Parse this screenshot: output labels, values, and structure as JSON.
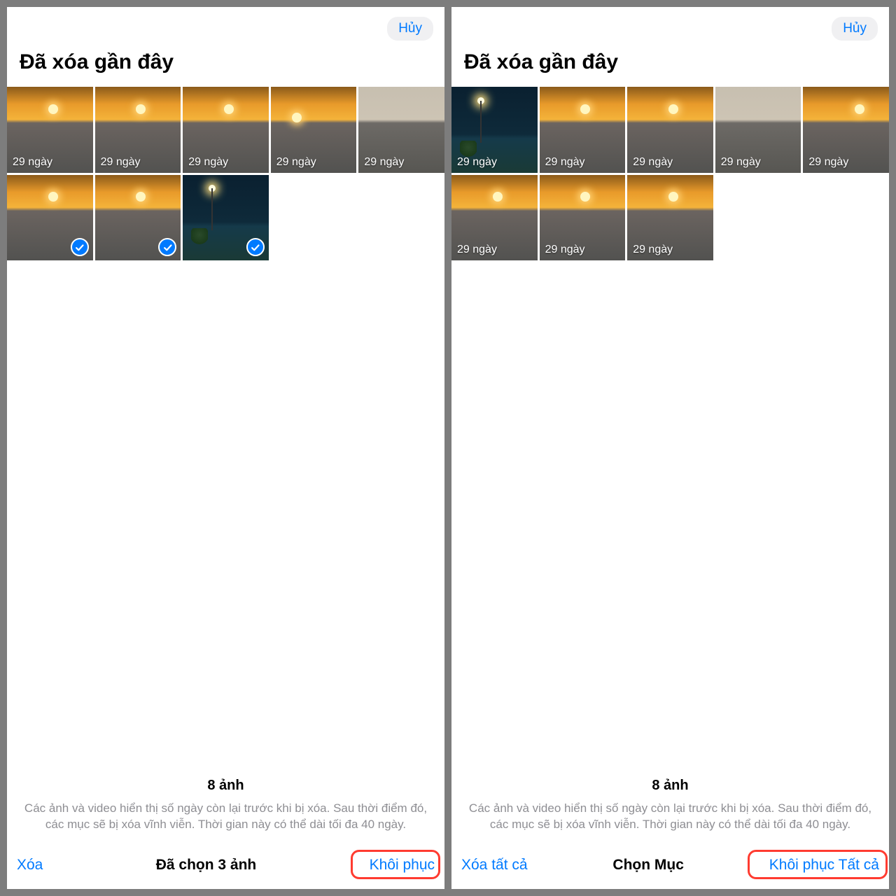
{
  "left": {
    "cancel": "Hủy",
    "title": "Đã xóa gần đây",
    "thumbs": [
      {
        "days": "29 ngày",
        "style": "sunset",
        "selected": false
      },
      {
        "days": "29 ngày",
        "style": "sunset",
        "selected": false
      },
      {
        "days": "29 ngày",
        "style": "sunset",
        "selected": false
      },
      {
        "days": "29 ngày",
        "style": "sunset_left",
        "selected": false
      },
      {
        "days": "29 ngày",
        "style": "sea",
        "selected": false
      },
      {
        "days": "",
        "style": "sunset",
        "selected": true
      },
      {
        "days": "",
        "style": "sunset",
        "selected": true
      },
      {
        "days": "",
        "style": "night",
        "selected": true
      }
    ],
    "count": "8 ảnh",
    "info": "Các ảnh và video hiển thị số ngày còn lại trước khi bị xóa. Sau thời điểm đó, các mục sẽ bị xóa vĩnh viễn. Thời gian này có thể dài tối đa 40 ngày.",
    "bb_left": "Xóa",
    "bb_center": "Đã chọn 3 ảnh",
    "bb_right": "Khôi phục"
  },
  "right": {
    "cancel": "Hủy",
    "title": "Đã xóa gần đây",
    "thumbs": [
      {
        "days": "29 ngày",
        "style": "night",
        "selected": false
      },
      {
        "days": "29 ngày",
        "style": "sunset",
        "selected": false
      },
      {
        "days": "29 ngày",
        "style": "sunset",
        "selected": false
      },
      {
        "days": "29 ngày",
        "style": "sea",
        "selected": false
      },
      {
        "days": "29 ngày",
        "style": "sunset_right",
        "selected": false
      },
      {
        "days": "29 ngày",
        "style": "sunset",
        "selected": false
      },
      {
        "days": "29 ngày",
        "style": "sunset",
        "selected": false
      },
      {
        "days": "29 ngày",
        "style": "sunset",
        "selected": false
      }
    ],
    "count": "8 ảnh",
    "info": "Các ảnh và video hiển thị số ngày còn lại trước khi bị xóa. Sau thời điểm đó, các mục sẽ bị xóa vĩnh viễn. Thời gian này có thể dài tối đa 40 ngày.",
    "bb_left": "Xóa tất cả",
    "bb_center": "Chọn Mục",
    "bb_right": "Khôi phục Tất cả"
  }
}
